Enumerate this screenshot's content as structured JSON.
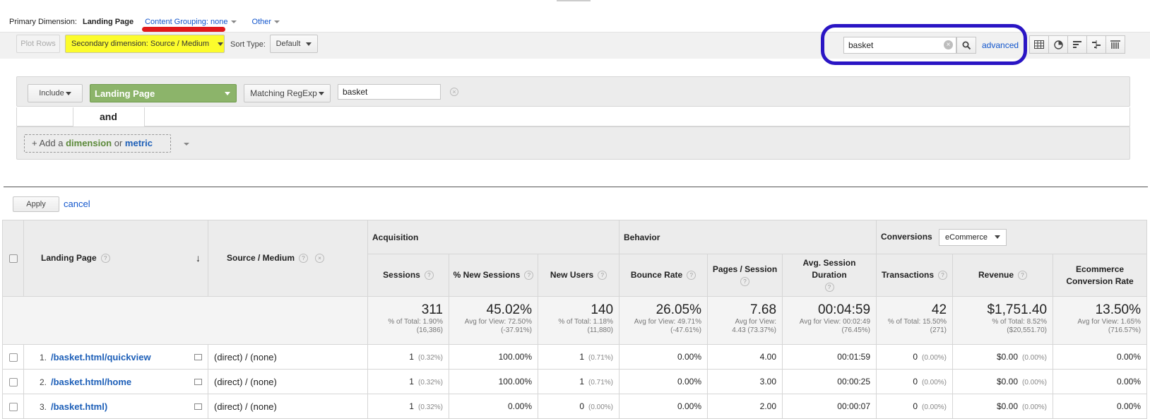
{
  "primary": {
    "label": "Primary Dimension:",
    "active": "Landing Page",
    "content_grouping": "Content Grouping: none",
    "other": "Other"
  },
  "toolbar": {
    "plot_rows": "Plot Rows",
    "secondary_dimension": "Secondary dimension: Source / Medium",
    "sort_type_label": "Sort Type:",
    "sort_type_value": "Default",
    "search_value": "basket",
    "advanced": "advanced"
  },
  "filter": {
    "include": "Include",
    "dimension": "Landing Page",
    "match": "Matching RegExp",
    "value": "basket",
    "and": "and",
    "add_prefix": "+ Add a",
    "add_dimension": "dimension",
    "add_or": "or",
    "add_metric": "metric",
    "apply": "Apply",
    "cancel": "cancel"
  },
  "table": {
    "groups": {
      "acquisition": "Acquisition",
      "behavior": "Behavior",
      "conversions": "Conversions",
      "conversions_select": "eCommerce"
    },
    "columns": {
      "landing_page": "Landing Page",
      "source_medium": "Source / Medium",
      "sessions": "Sessions",
      "new_sessions": "% New Sessions",
      "new_users": "New Users",
      "bounce_rate": "Bounce Rate",
      "pages_session": "Pages / Session",
      "avg_duration": "Avg. Session Duration",
      "transactions": "Transactions",
      "revenue": "Revenue",
      "ecom_rate": "Ecommerce Conversion Rate"
    },
    "totals": {
      "sessions": {
        "main": "311",
        "sub1": "% of Total: 1.90%",
        "sub2": "(16,386)"
      },
      "new_sessions": {
        "main": "45.02%",
        "sub1": "Avg for View: 72.50%",
        "sub2": "(-37.91%)"
      },
      "new_users": {
        "main": "140",
        "sub1": "% of Total: 1.18%",
        "sub2": "(11,880)"
      },
      "bounce_rate": {
        "main": "26.05%",
        "sub1": "Avg for View: 49.71%",
        "sub2": "(-47.61%)"
      },
      "pages_session": {
        "main": "7.68",
        "sub1": "Avg for View:",
        "sub2": "4.43 (73.37%)"
      },
      "avg_duration": {
        "main": "00:04:59",
        "sub1": "Avg for View: 00:02:49",
        "sub2": "(76.45%)"
      },
      "transactions": {
        "main": "42",
        "sub1": "% of Total: 15.50%",
        "sub2": "(271)"
      },
      "revenue": {
        "main": "$1,751.40",
        "sub1": "% of Total: 8.52%",
        "sub2": "($20,551.70)"
      },
      "ecom_rate": {
        "main": "13.50%",
        "sub1": "Avg for View: 1.65%",
        "sub2": "(716.57%)"
      }
    },
    "rows": [
      {
        "index": "1.",
        "page": "/basket.html/quickview",
        "source": "(direct) / (none)",
        "sessions": "1",
        "sessions_pct": "(0.32%)",
        "new_sessions": "100.00%",
        "new_users": "1",
        "new_users_pct": "(0.71%)",
        "bounce": "0.00%",
        "pages": "4.00",
        "duration": "00:01:59",
        "transactions": "0",
        "transactions_pct": "(0.00%)",
        "revenue": "$0.00",
        "revenue_pct": "(0.00%)",
        "ecom": "0.00%"
      },
      {
        "index": "2.",
        "page": "/basket.html/home",
        "source": "(direct) / (none)",
        "sessions": "1",
        "sessions_pct": "(0.32%)",
        "new_sessions": "100.00%",
        "new_users": "1",
        "new_users_pct": "(0.71%)",
        "bounce": "0.00%",
        "pages": "3.00",
        "duration": "00:00:25",
        "transactions": "0",
        "transactions_pct": "(0.00%)",
        "revenue": "$0.00",
        "revenue_pct": "(0.00%)",
        "ecom": "0.00%"
      },
      {
        "index": "3.",
        "page": "/basket.html)",
        "source": "(direct) / (none)",
        "sessions": "1",
        "sessions_pct": "(0.32%)",
        "new_sessions": "0.00%",
        "new_users": "0",
        "new_users_pct": "(0.00%)",
        "bounce": "0.00%",
        "pages": "2.00",
        "duration": "00:00:07",
        "transactions": "0",
        "transactions_pct": "(0.00%)",
        "revenue": "$0.00",
        "revenue_pct": "(0.00%)",
        "ecom": "0.00%"
      }
    ]
  },
  "colors": {
    "link": "#1155cc",
    "highlight_yellow": "#fcfc2c",
    "scribble_red": "#e0191b",
    "ring_blue": "#2a15c4",
    "dimension_green": "#8cb46a"
  }
}
